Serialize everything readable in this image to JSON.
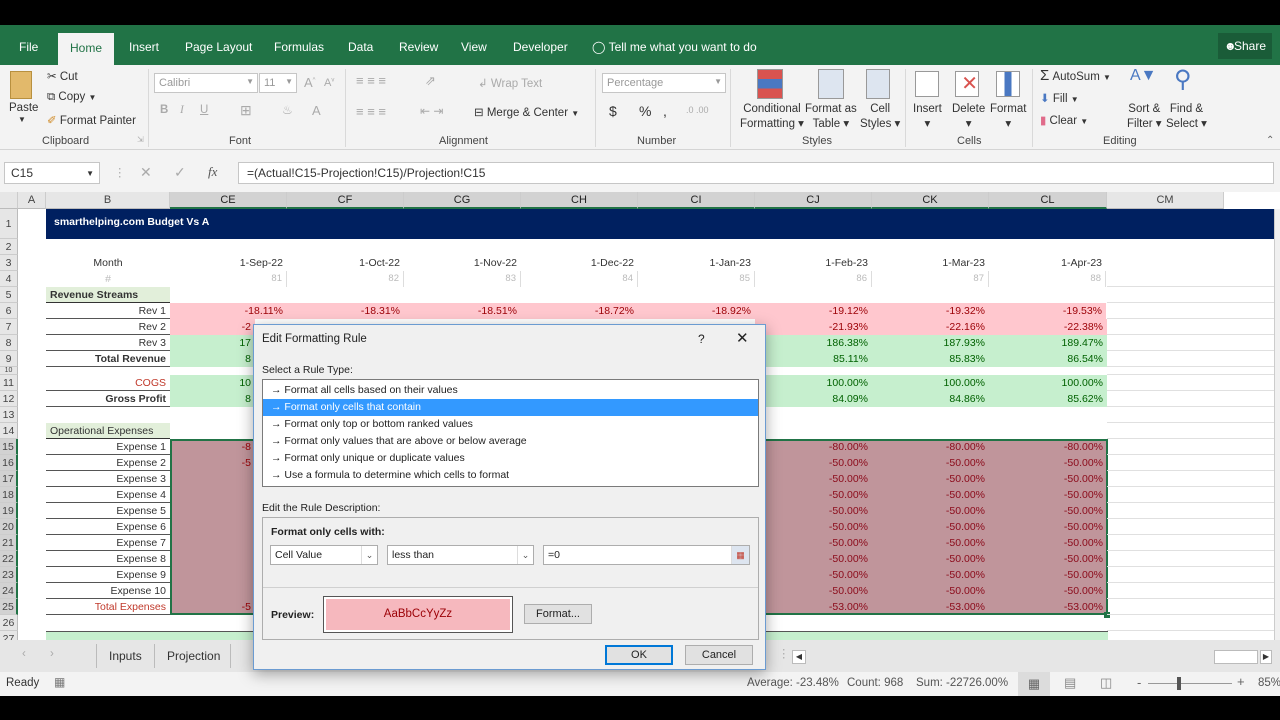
{
  "ribbon_tabs": [
    "File",
    "Home",
    "Insert",
    "Page Layout",
    "Formulas",
    "Data",
    "Review",
    "View",
    "Developer"
  ],
  "tell_me": "Tell me what you want to do",
  "share": "Share",
  "clipboard": {
    "paste": "Paste",
    "cut": "Cut",
    "copy": "Copy",
    "format_painter": "Format Painter",
    "label": "Clipboard"
  },
  "font": {
    "name": "Calibri",
    "size": "11",
    "bold": "B",
    "italic": "I",
    "underline": "U",
    "label": "Font"
  },
  "alignment": {
    "wrap": "Wrap Text",
    "merge": "Merge & Center",
    "label": "Alignment"
  },
  "number": {
    "format": "Percentage",
    "currency": "$",
    "percent": "%",
    "comma": ",",
    "label": "Number"
  },
  "styles": {
    "conditional": "Conditional",
    "conditional2": "Formatting",
    "format_table": "Format as",
    "format_table2": "Table",
    "cell_styles": "Cell",
    "cell_styles2": "Styles",
    "label": "Styles"
  },
  "cells": {
    "insert": "Insert",
    "delete": "Delete",
    "format": "Format",
    "label": "Cells"
  },
  "editing": {
    "autosum": "AutoSum",
    "fill": "Fill",
    "clear": "Clear",
    "sort": "Sort &",
    "sort2": "Filter",
    "find": "Find &",
    "find2": "Select",
    "label": "Editing"
  },
  "formula_bar": {
    "name_box": "C15",
    "fx": "fx",
    "formula": "=(Actual!C15-Projection!C15)/Projection!C15"
  },
  "columns": [
    "A",
    "B",
    "CE",
    "CF",
    "CG",
    "CH",
    "CI",
    "CJ",
    "CK",
    "CL",
    "CM"
  ],
  "rows": [
    "1",
    "2",
    "3",
    "4",
    "5",
    "6",
    "7",
    "8",
    "9",
    "10",
    "11",
    "12",
    "13",
    "14",
    "15",
    "16",
    "17",
    "18",
    "19",
    "20",
    "21",
    "22",
    "23",
    "24",
    "25",
    "26",
    "27"
  ],
  "sheet": {
    "title": "smarthelping.com Budget Vs A",
    "month_label": "Month",
    "hash_label": "#",
    "months": [
      "1-Sep-22",
      "1-Oct-22",
      "1-Nov-22",
      "1-Dec-22",
      "1-Jan-23",
      "1-Feb-23",
      "1-Mar-23",
      "1-Apr-23"
    ],
    "month_numbers": [
      "81",
      "82",
      "83",
      "84",
      "85",
      "86",
      "87",
      "88"
    ],
    "revenue_streams": "Revenue Streams",
    "operational_expenses": "Operational Expenses",
    "row_labels": {
      "r6": "Rev 1",
      "r7": "Rev 2",
      "r8": "Rev 3",
      "r9": "Total Revenue",
      "r11": "COGS",
      "r12": "Gross Profit",
      "r15": "Expense 1",
      "r16": "Expense 2",
      "r17": "Expense 3",
      "r18": "Expense 4",
      "r19": "Expense 5",
      "r20": "Expense 6",
      "r21": "Expense 7",
      "r22": "Expense 8",
      "r23": "Expense 9",
      "r24": "Expense 10",
      "r25": "Total Expenses"
    },
    "rev1": [
      "-18.11%",
      "-18.31%",
      "-18.51%",
      "-18.72%",
      "-18.92%",
      "-19.12%",
      "-19.32%",
      "-19.53%"
    ],
    "rev2_visible": [
      "-21.93%",
      "-22.16%",
      "-22.38%"
    ],
    "rev3_visible": [
      "186.38%",
      "187.93%",
      "189.47%"
    ],
    "total_revenue_visible": [
      "85.11%",
      "85.83%",
      "86.54%"
    ],
    "cogs_visible": [
      "100.00%",
      "100.00%",
      "100.00%"
    ],
    "gross_profit_visible": [
      "84.09%",
      "84.86%",
      "85.62%"
    ],
    "expense1_visible": [
      "-80.00%",
      "-80.00%",
      "-80.00%"
    ],
    "expense_other_visible": [
      "-50.00%",
      "-50.00%",
      "-50.00%"
    ],
    "total_expenses_visible": [
      "-53.00%",
      "-53.00%",
      "-53.00%"
    ],
    "partial_left": {
      "r7": "-2",
      "r8": "17",
      "r9": "8",
      "r11": "10",
      "r12": "8",
      "r15": "-8",
      "r16": "-5",
      "r25": "-5"
    }
  },
  "sheet_tabs": [
    "Inputs",
    "Projection"
  ],
  "status": {
    "ready": "Ready",
    "average": "Average: -23.48%",
    "count": "Count: 968",
    "sum": "Sum: -22726.00%",
    "zoom": "85%"
  },
  "dialog": {
    "title": "Edit Formatting Rule",
    "help": "?",
    "select_rule_type": "Select a Rule Type:",
    "rule_types": [
      "Format all cells based on their values",
      "Format only cells that contain",
      "Format only top or bottom ranked values",
      "Format only values that are above or below average",
      "Format only unique or duplicate values",
      "Use a formula to determine which cells to format"
    ],
    "selected_rule_index": 1,
    "edit_rule_description": "Edit the Rule Description:",
    "format_only_cells_with": "Format only cells with:",
    "condition_field": "Cell Value",
    "operator": "less than",
    "value": "=0",
    "preview_label": "Preview:",
    "preview_text": "AaBbCcYyZz",
    "format_button": "Format...",
    "ok": "OK",
    "cancel": "Cancel"
  },
  "colors": {
    "excel_green": "#217346",
    "title_navy": "#002060",
    "bad_fill": "#ffc7ce",
    "bad_text": "#9c0006",
    "good_fill": "#c6efce",
    "good_text": "#006100",
    "expense_fill": "#c0959b",
    "select_blue": "#3399ff"
  }
}
